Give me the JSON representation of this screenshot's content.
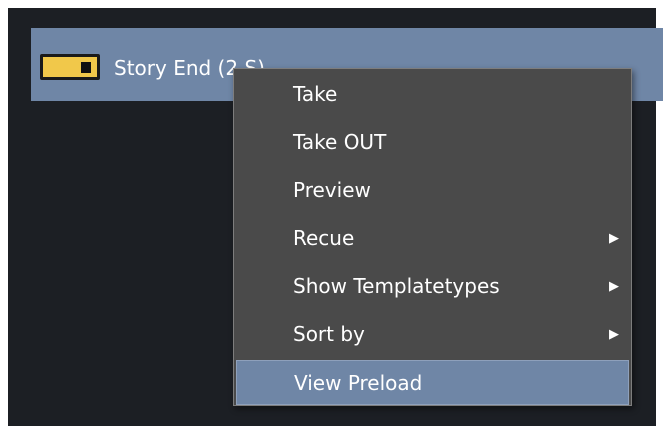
{
  "story": {
    "label": "Story End (2 S)",
    "icon": "story-toggle-icon",
    "icon_color": "#f1c84a"
  },
  "context_menu": {
    "items": [
      {
        "label": "Take",
        "has_submenu": false
      },
      {
        "label": "Take OUT",
        "has_submenu": false
      },
      {
        "label": "Preview",
        "has_submenu": false
      },
      {
        "label": "Recue",
        "has_submenu": true
      },
      {
        "label": "Show Templatetypes",
        "has_submenu": true
      },
      {
        "label": "Sort by",
        "has_submenu": true
      },
      {
        "label": "View Preload",
        "has_submenu": false,
        "highlighted": true
      }
    ],
    "submenu_arrow": "▶"
  },
  "colors": {
    "panel_bg": "#1c1f24",
    "selection": "#6f86a6",
    "menu_bg": "#4a4a4a"
  }
}
